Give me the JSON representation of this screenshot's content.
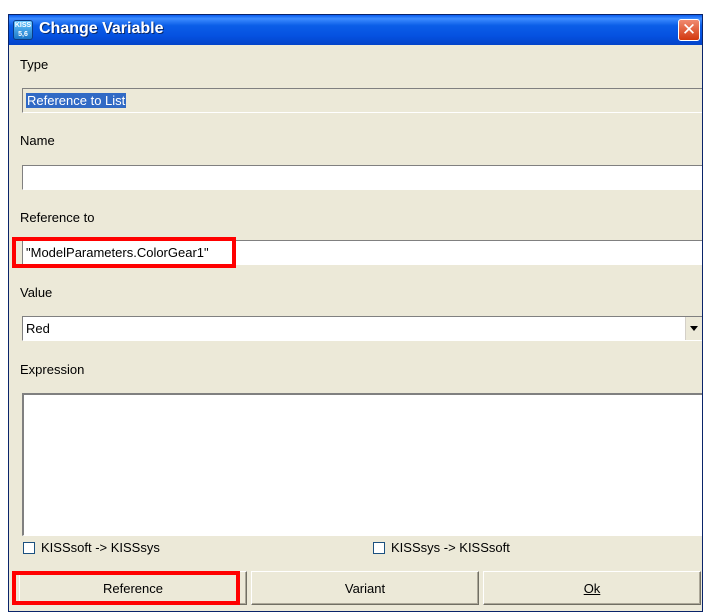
{
  "window": {
    "title": "Change Variable",
    "icon_text": "KISS 5,6"
  },
  "type_section": {
    "label": "Type",
    "value": "Reference to List"
  },
  "name_section": {
    "label": "Name",
    "value": ""
  },
  "reference_section": {
    "label": "Reference to",
    "value": "\"ModelParameters.ColorGear1\""
  },
  "value_section": {
    "label": "Value",
    "value": "Red"
  },
  "expression_section": {
    "label": "Expression",
    "value": ""
  },
  "checkboxes": [
    {
      "label": "KISSsoft -> KISSsys",
      "checked": false
    },
    {
      "label": "KISSsys -> KISSsoft",
      "checked": false
    }
  ],
  "buttons": {
    "reference": "Reference",
    "variant": "Variant",
    "ok": "Ok"
  },
  "colors": {
    "titlebar": "#0551e0",
    "dialog_bg": "#ece9d8",
    "highlight": "#ff0000",
    "selection": "#316ac5"
  }
}
